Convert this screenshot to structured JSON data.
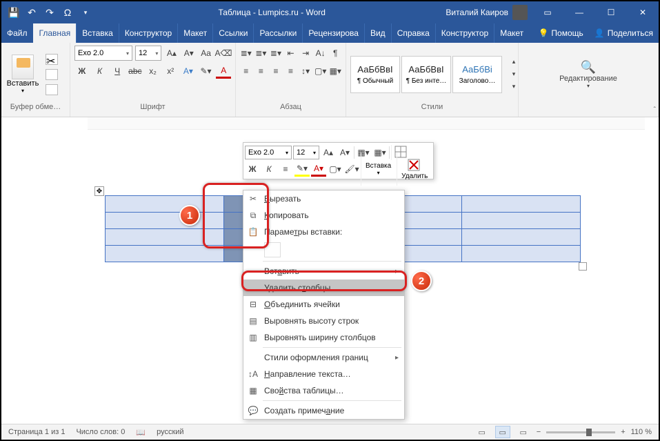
{
  "title": "Таблица - Lumpics.ru - Word",
  "user": "Виталий Каиров",
  "tabs": {
    "file": "Файл",
    "home": "Главная",
    "insert": "Вставка",
    "design": "Конструктор",
    "layout": "Макет",
    "references": "Ссылки",
    "mailings": "Рассылки",
    "review": "Рецензирова",
    "view": "Вид",
    "help": "Справка",
    "table_design": "Конструктор",
    "table_layout": "Макет",
    "tell_me": "Помощь",
    "share": "Поделиться"
  },
  "ribbon": {
    "paste": "Вставить",
    "clipboard": "Буфер обме…",
    "font_name": "Exo 2.0",
    "font_size": "12",
    "font_group": "Шрифт",
    "paragraph_group": "Абзац",
    "styles_group": "Стили",
    "style1_sample": "АаБбВвІ",
    "style1_name": "¶ Обычный",
    "style2_sample": "АаБбВвІ",
    "style2_name": "¶ Без инте…",
    "style3_sample": "АаБбВі",
    "style3_name": "Заголово…",
    "editing": "Редактирование"
  },
  "minibar": {
    "font": "Exo 2.0",
    "size": "12",
    "insert": "Вставка",
    "delete": "Удалить"
  },
  "ctx": {
    "cut": "Вырезать",
    "copy": "Копировать",
    "paste_options": "Параметры вставки:",
    "insert": "Вставить",
    "delete_columns": "Удалить столбцы",
    "merge": "Объединить ячейки",
    "distribute_rows": "Выровнять высоту строк",
    "distribute_cols": "Выровнять ширину столбцов",
    "border_styles": "Стили оформления границ",
    "text_direction": "Направление текста…",
    "table_props": "Свойства таблицы…",
    "new_comment": "Создать примечание"
  },
  "status": {
    "page": "Страница 1 из 1",
    "words": "Число слов: 0",
    "lang": "русский",
    "zoom": "110 %"
  },
  "badges": {
    "b1": "1",
    "b2": "2"
  }
}
